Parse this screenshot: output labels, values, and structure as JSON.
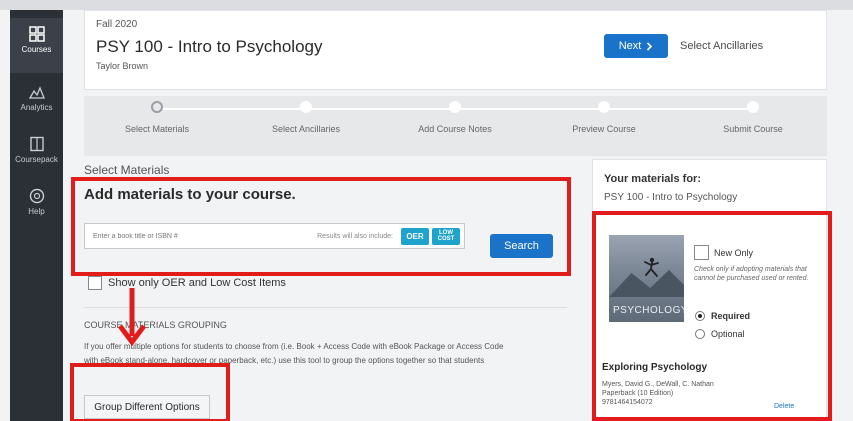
{
  "sidebar": {
    "items": [
      {
        "label": "Courses",
        "icon": "grid-icon",
        "active": true
      },
      {
        "label": "Analytics",
        "icon": "chart-icon",
        "active": false
      },
      {
        "label": "Coursepack",
        "icon": "book-icon",
        "active": false
      },
      {
        "label": "Help",
        "icon": "help-icon",
        "active": false
      }
    ]
  },
  "header": {
    "term": "Fall 2020",
    "course_title": "PSY 100 - Intro to Psychology",
    "instructor": "Taylor Brown",
    "next_label": "Next",
    "next_step_text": "Select Ancillaries"
  },
  "stepper": {
    "steps": [
      "Select Materials",
      "Select Ancillaries",
      "Add Course Notes",
      "Preview Course",
      "Submit Course"
    ],
    "current_index": 0
  },
  "materials": {
    "section_label": "Select Materials",
    "add_title": "Add materials to your course.",
    "search_placeholder": "Enter a book title or ISBN #",
    "results_note": "Results will also include:",
    "badge_oer": "OER",
    "badge_low_1": "LOW",
    "badge_low_2": "COST",
    "search_button": "Search",
    "oer_checkbox_label": "Show only OER and Low Cost Items"
  },
  "grouping": {
    "heading": "COURSE MATERIALS GROUPING",
    "desc_line1": "If you offer multiple options for students to choose from (i.e. Book + Access Code with eBook Package or Access Code",
    "desc_line2": "with eBook stand-alone, hardcover or paperback, etc.) use this tool to group the options together so that students",
    "button_label": "Group Different Options"
  },
  "right_panel": {
    "title": "Your materials for:",
    "course": "PSY 100 - Intro to Psychology",
    "item": {
      "cover_text": "PSYCHOLOGY",
      "new_only_label": "New Only",
      "new_only_hint": "Check only if adopting materials that cannot be purchased used or rented.",
      "required_label": "Required",
      "optional_label": "Optional",
      "book_title": "Exploring Psychology",
      "authors": "Myers, David G., DeWall, C. Nathan",
      "edition": "Paperback (10 Edition)",
      "isbn": "9781464154072",
      "delete_label": "Delete"
    }
  },
  "colors": {
    "primary": "#1a73c8",
    "badge": "#1ea3cc",
    "annotation": "#e21b1b",
    "sidebar": "#2b2f36"
  }
}
